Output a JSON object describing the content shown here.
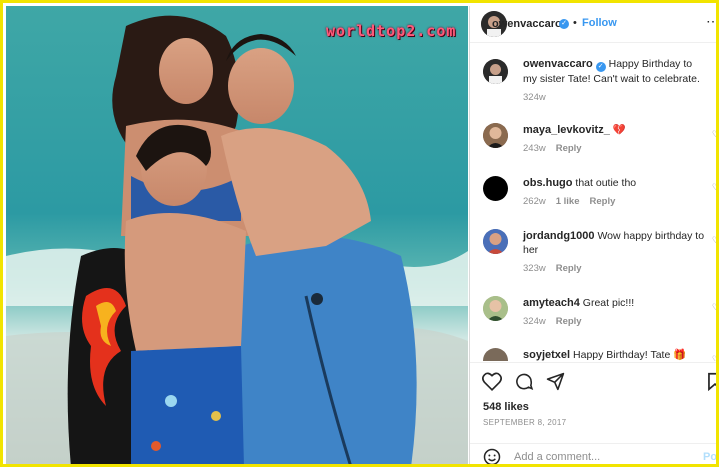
{
  "watermark": "worldtop2.com",
  "post": {
    "author": "owenvaccaro",
    "follow_label": "Follow",
    "separator": "•",
    "more_icon": "more-icon",
    "caption": "Happy Birthday to my sister Tate! Can't wait to celebrate.",
    "caption_age": "324w",
    "likes": "548 likes",
    "date": "SEPTEMBER 8, 2017",
    "add_comment_placeholder": "Add a comment...",
    "post_label": "Post"
  },
  "comments": [
    {
      "user": "maya_levkovitz_",
      "text": "💔",
      "age": "243w",
      "likes": "",
      "reply": "Reply"
    },
    {
      "user": "obs.hugo",
      "text": "that outie tho",
      "age": "262w",
      "likes": "1 like",
      "reply": "Reply"
    },
    {
      "user": "jordandg1000",
      "text": "Wow happy birthday to her",
      "age": "323w",
      "likes": "",
      "reply": "Reply"
    },
    {
      "user": "amyteach4",
      "text": "Great pic!!!",
      "age": "324w",
      "likes": "",
      "reply": "Reply"
    },
    {
      "user": "soyjetxel",
      "text": "Happy Birthday! Tate 🎁",
      "age": "",
      "likes": "",
      "reply": ""
    }
  ],
  "colors": {
    "accent": "#3897f0",
    "frame": "#f2e400",
    "muted": "#8e8e8e"
  }
}
